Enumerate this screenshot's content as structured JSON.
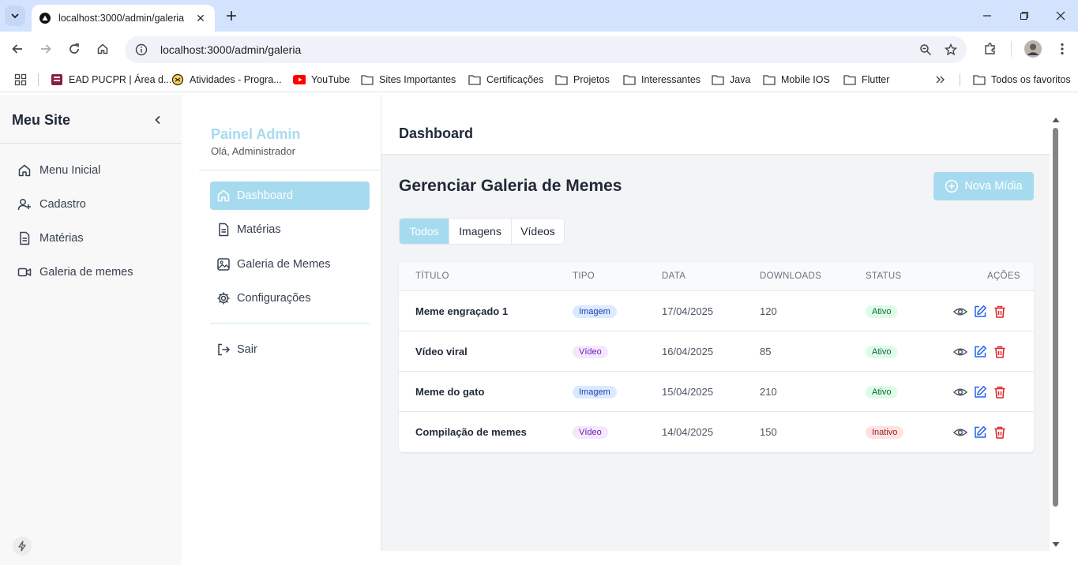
{
  "browser": {
    "tab_title": "localhost:3000/admin/galeria",
    "url": "localhost:3000/admin/galeria",
    "bookmarks": [
      {
        "label": "EAD PUCPR | Área d...",
        "icon": "pucpr-icon"
      },
      {
        "label": "Atividades - Progra...",
        "icon": "activity-icon"
      },
      {
        "label": "YouTube",
        "icon": "youtube-icon"
      },
      {
        "label": "Sites Importantes",
        "icon": "folder-icon"
      },
      {
        "label": "Certificações",
        "icon": "folder-icon"
      },
      {
        "label": "Projetos",
        "icon": "folder-icon"
      },
      {
        "label": "Interessantes",
        "icon": "folder-icon"
      },
      {
        "label": "Java",
        "icon": "folder-icon"
      },
      {
        "label": "Mobile IOS",
        "icon": "folder-icon"
      },
      {
        "label": "Flutter",
        "icon": "folder-icon"
      }
    ],
    "all_bookmarks": "Todos os favoritos"
  },
  "sidebar": {
    "brand": "Meu Site",
    "items": [
      {
        "label": "Menu Inicial",
        "icon": "home-icon"
      },
      {
        "label": "Cadastro",
        "icon": "user-plus-icon"
      },
      {
        "label": "Matérias",
        "icon": "document-icon"
      },
      {
        "label": "Galeria de memes",
        "icon": "video-icon"
      }
    ]
  },
  "admin": {
    "title": "Painel Admin",
    "greeting": "Olá, Administrador",
    "nav": [
      {
        "label": "Dashboard",
        "icon": "home-icon",
        "active": true
      },
      {
        "label": "Matérias",
        "icon": "document-icon"
      },
      {
        "label": "Galeria de Memes",
        "icon": "image-icon"
      },
      {
        "label": "Configurações",
        "icon": "gear-icon"
      }
    ],
    "logout": "Sair"
  },
  "main": {
    "topbar_title": "Dashboard",
    "heading": "Gerenciar Galeria de Memes",
    "new_button": "Nova Mídia",
    "filters": [
      "Todos",
      "Imagens",
      "Vídeos"
    ],
    "active_filter": "Todos",
    "columns": [
      "TÍTULO",
      "TIPO",
      "DATA",
      "DOWNLOADS",
      "STATUS",
      "AÇÕES"
    ],
    "rows": [
      {
        "title": "Meme engraçado 1",
        "type": "Imagem",
        "date": "17/04/2025",
        "downloads": "120",
        "status": "Ativo"
      },
      {
        "title": "Vídeo viral",
        "type": "Vídeo",
        "date": "16/04/2025",
        "downloads": "85",
        "status": "Ativo"
      },
      {
        "title": "Meme do gato",
        "type": "Imagem",
        "date": "15/04/2025",
        "downloads": "210",
        "status": "Ativo"
      },
      {
        "title": "Compilação de memes",
        "type": "Vídeo",
        "date": "14/04/2025",
        "downloads": "150",
        "status": "Inativo"
      }
    ]
  },
  "colors": {
    "accent": "#a6dbef",
    "chrome_tabbar": "#d3e3fd",
    "edit": "#2563eb",
    "delete": "#dc2626"
  }
}
